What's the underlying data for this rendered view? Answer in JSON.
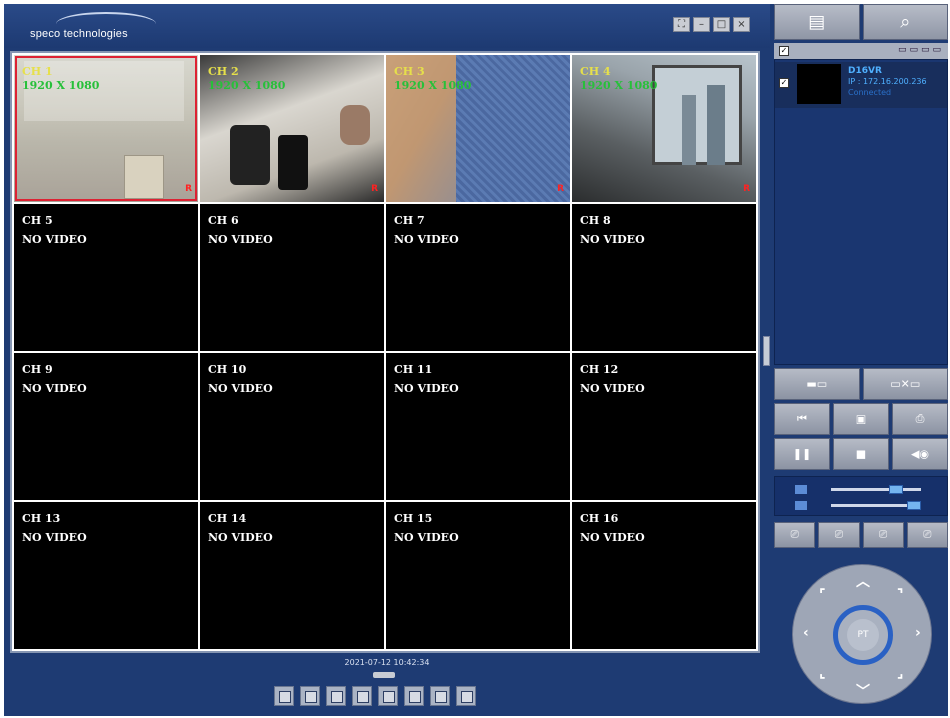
{
  "app": {
    "logo_text": "speco technologies",
    "window_buttons": [
      "full-screen",
      "minimize",
      "maximize",
      "close"
    ]
  },
  "channels": [
    {
      "label": "CH 1",
      "resolution": "1920 X 1080",
      "rec": "R",
      "has_video": true
    },
    {
      "label": "CH 2",
      "resolution": "1920 X 1080",
      "rec": "R",
      "has_video": true
    },
    {
      "label": "CH 3",
      "resolution": "1920 X 1080",
      "rec": "R",
      "has_video": true
    },
    {
      "label": "CH 4",
      "resolution": "1920 X 1080",
      "rec": "R",
      "has_video": true
    },
    {
      "label": "CH 5",
      "status": "NO VIDEO"
    },
    {
      "label": "CH 6",
      "status": "NO VIDEO"
    },
    {
      "label": "CH 7",
      "status": "NO VIDEO"
    },
    {
      "label": "CH 8",
      "status": "NO VIDEO"
    },
    {
      "label": "CH 9",
      "status": "NO VIDEO"
    },
    {
      "label": "CH 10",
      "status": "NO VIDEO"
    },
    {
      "label": "CH 11",
      "status": "NO VIDEO"
    },
    {
      "label": "CH 12",
      "status": "NO VIDEO"
    },
    {
      "label": "CH 13",
      "status": "NO VIDEO"
    },
    {
      "label": "CH 14",
      "status": "NO VIDEO"
    },
    {
      "label": "CH 15",
      "status": "NO VIDEO"
    },
    {
      "label": "CH 16",
      "status": "NO VIDEO"
    }
  ],
  "status_bar": {
    "timestamp": "2021-07-12 10:42:34"
  },
  "device_list": {
    "items": [
      {
        "name": "D16VR",
        "ip": "IP : 172.16.200.236",
        "status": "Connected"
      }
    ]
  },
  "ptz": {
    "center_label": "PT"
  },
  "colors": {
    "background": "#1e3b73",
    "channel_label_active": "#e6e04a",
    "resolution_text": "#27c03a",
    "record_indicator": "#ff2222",
    "selected_border": "#dd2233",
    "device_text": "#4fb0ff"
  }
}
